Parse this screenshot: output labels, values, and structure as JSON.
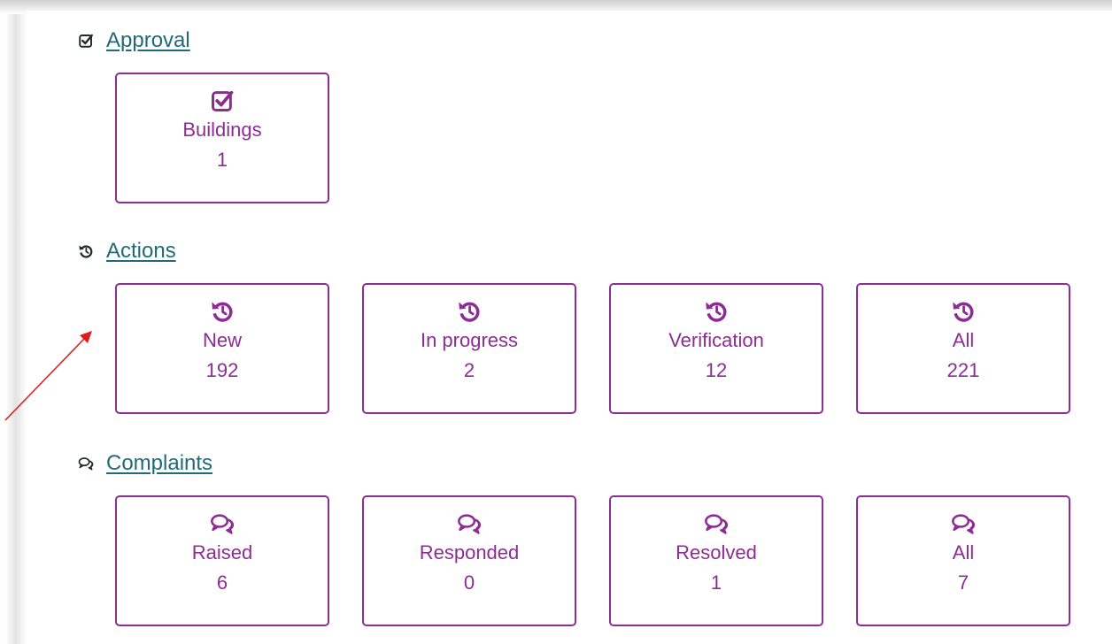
{
  "sections": {
    "approval": {
      "title": "Approval",
      "icon": "check-square-icon",
      "tiles": [
        {
          "label": "Buildings",
          "count": "1"
        }
      ]
    },
    "actions": {
      "title": "Actions",
      "icon": "history-icon",
      "tiles": [
        {
          "label": "New",
          "count": "192"
        },
        {
          "label": "In progress",
          "count": "2"
        },
        {
          "label": "Verification",
          "count": "12"
        },
        {
          "label": "All",
          "count": "221"
        }
      ]
    },
    "complaints": {
      "title": "Complaints",
      "icon": "comments-icon",
      "tiles": [
        {
          "label": "Raised",
          "count": "6"
        },
        {
          "label": "Responded",
          "count": "0"
        },
        {
          "label": "Resolved",
          "count": "1"
        },
        {
          "label": "All",
          "count": "7"
        }
      ]
    }
  },
  "colors": {
    "tile_accent": "#8e2c95",
    "link": "#1f6b78",
    "annotation_arrow": "#e01b1b"
  }
}
